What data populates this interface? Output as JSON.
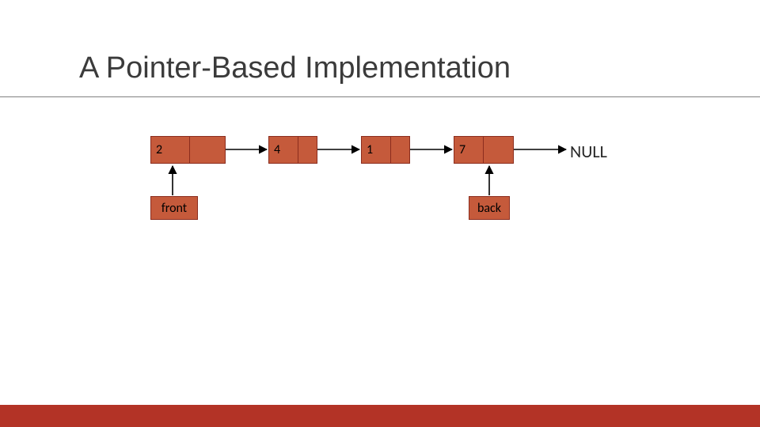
{
  "title": "A Pointer-Based Implementation",
  "nodes": [
    "2",
    "4",
    "1",
    "7"
  ],
  "front_label": "front",
  "back_label": "back",
  "null_label": "NULL",
  "chart_data": {
    "type": "table",
    "title": "Linked-list queue — pointer-based implementation",
    "description": "Four singly-linked nodes; 'front' points to the first node and 'back' points to the last node; the last node's next pointer is NULL.",
    "nodes": [
      {
        "value": 2,
        "next": "node[1]"
      },
      {
        "value": 4,
        "next": "node[2]"
      },
      {
        "value": 1,
        "next": "node[3]"
      },
      {
        "value": 7,
        "next": "NULL"
      }
    ],
    "pointers": {
      "front": "node[0]",
      "back": "node[3]"
    }
  }
}
